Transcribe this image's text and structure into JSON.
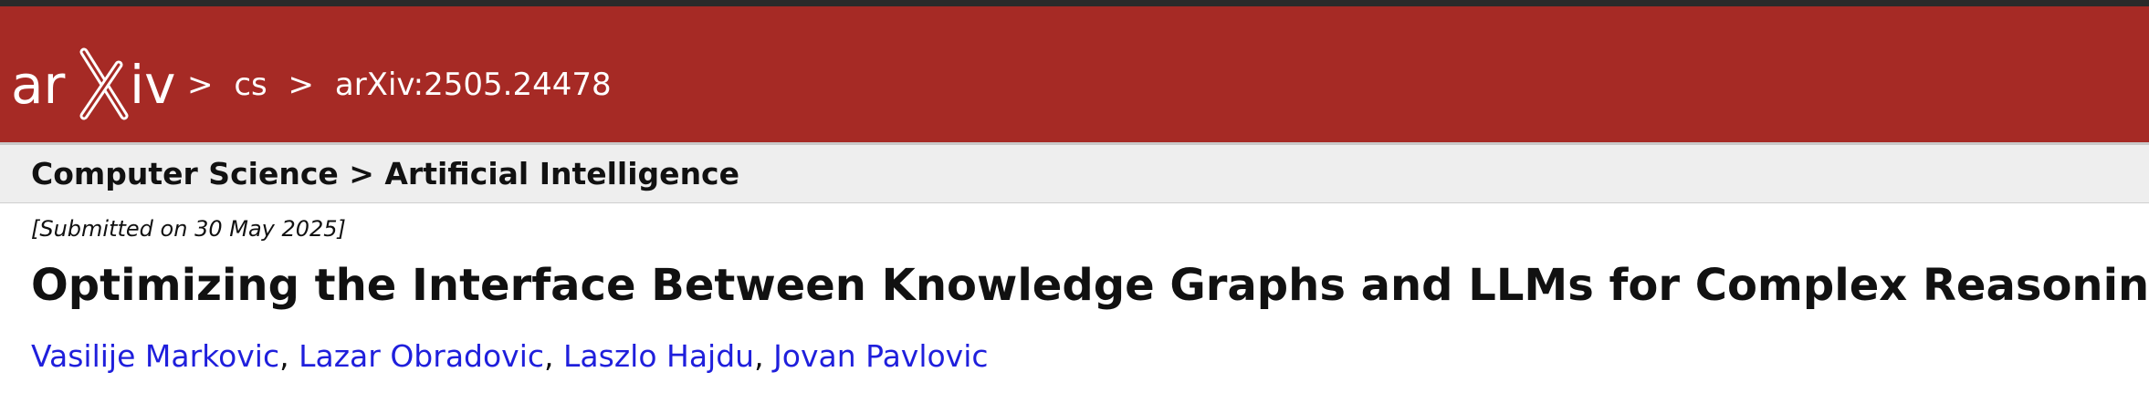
{
  "header": {
    "logo_text": "arXiv",
    "breadcrumb": {
      "sep": ">",
      "category": "cs",
      "paper_id": "arXiv:2505.24478"
    }
  },
  "subheader": {
    "subject": "Computer Science > Artificial Intelligence"
  },
  "paper": {
    "submitted": "[Submitted on 30 May 2025]",
    "title": "Optimizing the Interface Between Knowledge Graphs and LLMs for Complex Reasoning",
    "authors": [
      "Vasilije Markovic",
      "Lazar Obradovic",
      "Laszlo Hajdu",
      "Jovan Pavlovic"
    ],
    "author_sep": ","
  },
  "colors": {
    "header_bg": "#a62a25",
    "subheader_bg": "#eeeeee",
    "link": "#1f1fdc"
  }
}
